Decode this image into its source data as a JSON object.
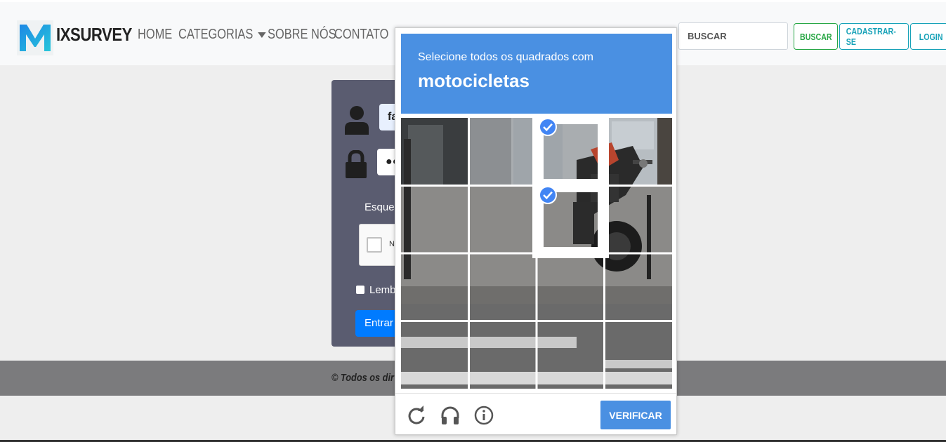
{
  "navbar": {
    "brand": "IXSURVEY",
    "links": [
      "HOME",
      "CATEGORIAS",
      "SOBRE NÓS",
      "CONTATO"
    ],
    "search_placeholder": "BUSCAR",
    "buttons": {
      "search": "BUSCAR",
      "signup": "CADASTRAR-SE",
      "login": "LOGIN"
    }
  },
  "login": {
    "username_value": "fa",
    "password_value": "●●",
    "forgot_text": "Esqueci",
    "recaptcha_label": "N",
    "remember_label": "Lembr",
    "submit_label": "Entrar"
  },
  "footer": {
    "text": "© Todos os dir"
  },
  "captcha": {
    "instruction": "Selecione todos os quadrados com",
    "target": "motocicletas",
    "grid_rows": 4,
    "grid_cols": 4,
    "selected_tiles": [
      [
        0,
        2
      ],
      [
        1,
        2
      ]
    ],
    "verify_label": "VERIFICAR",
    "icons": [
      "reload-icon",
      "headphones-icon",
      "info-icon"
    ]
  },
  "colors": {
    "captcha_blue": "#4a90e2",
    "success_green": "#28a745",
    "info_teal": "#17a2b8",
    "primary_blue": "#007bff",
    "login_panel": "#5a5c70",
    "footer_gray": "#7b7b7d"
  }
}
